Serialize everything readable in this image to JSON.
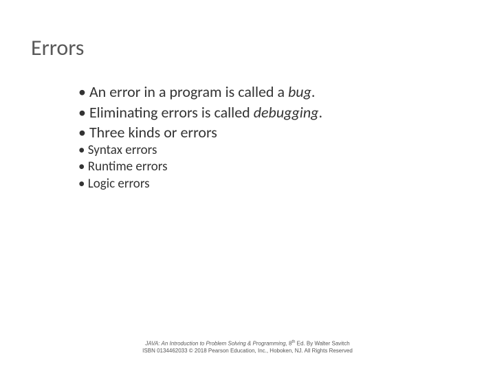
{
  "title": "Errors",
  "bullets": {
    "b1_pre": "An error in a program is called a ",
    "b1_em": "bug",
    "b1_post": ".",
    "b2_pre": "Eliminating errors is called ",
    "b2_em": "debugging",
    "b2_post": ".",
    "b3": "Three kinds or errors",
    "sub1": "Syntax errors",
    "sub2": "Runtime errors",
    "sub3": "Logic errors"
  },
  "footer": {
    "book": "JAVA: An Introduction to Problem Solving & Programming",
    "ed_pre": ", 8",
    "ed_sup": "th",
    "ed_post": " Ed. By Walter Savitch",
    "line2": "ISBN 0134462033  © 2018 Pearson Education, Inc., Hoboken, NJ. All Rights Reserved"
  }
}
